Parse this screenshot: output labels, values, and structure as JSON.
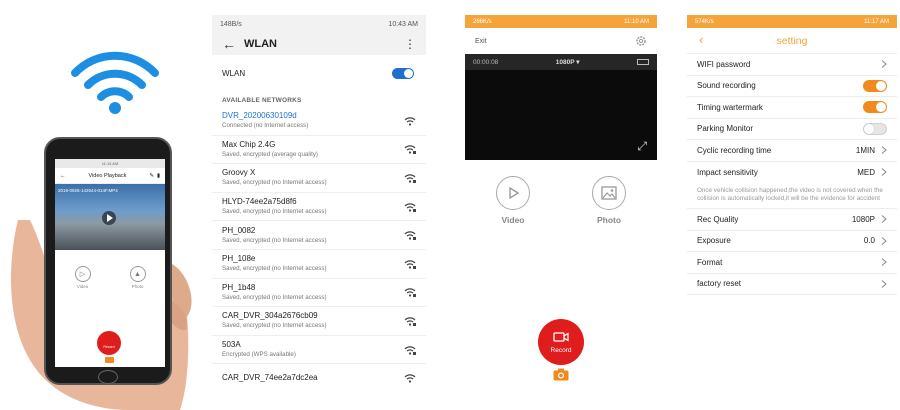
{
  "hero": {
    "phone_status_time": "11:14 AM",
    "phone_title": "Video Playback",
    "phone_file_name": "2019-0926-142544-014F.MP4",
    "phone_video_label": "Video",
    "phone_photo_label": "Photo",
    "phone_record_label": "Record"
  },
  "wlan": {
    "status_left": "148B/s",
    "status_right": "10:43 AM",
    "title": "WLAN",
    "toggle_label": "WLAN",
    "section_label": "AVAILABLE NETWORKS",
    "networks": [
      {
        "name": "DVR_20200630109d",
        "status": "Connected (no Internet access)"
      },
      {
        "name": "Max Chip 2.4G",
        "status": "Saved, encrypted (average quality)"
      },
      {
        "name": "Groovy X",
        "status": "Saved, encrypted (no Internet access)"
      },
      {
        "name": "HLYD-74ee2a75d8f6",
        "status": "Saved, encrypted (no Internet access)"
      },
      {
        "name": "PH_0082",
        "status": "Saved, encrypted (no Internet access)"
      },
      {
        "name": "PH_108e",
        "status": "Saved, encrypted (no Internet access)"
      },
      {
        "name": "PH_1b48",
        "status": "Saved, encrypted (no Internet access)"
      },
      {
        "name": "CAR_DVR_304a2676cb09",
        "status": "Saved, encrypted (no Internet access)"
      },
      {
        "name": "503A",
        "status": "Encrypted (WPS available)"
      },
      {
        "name": "CAR_DVR_74ee2a7dc2ea",
        "status": ""
      }
    ]
  },
  "camera": {
    "status_left": "266K/s",
    "status_right": "11:10 AM",
    "exit_label": "Exit",
    "timer": "00:00:08",
    "resolution": "1080P",
    "video_label": "Video",
    "photo_label": "Photo",
    "record_label": "Record"
  },
  "settings": {
    "status_left": "574K/s",
    "status_right": "11:17 AM",
    "title": "setting",
    "wifi_password": "WIFI password",
    "sound_recording": "Sound recording",
    "timing_watermark": "Timing wartermark",
    "parking_monitor": "Parking Monitor",
    "cyclic_recording": "Cyclic recording time",
    "cyclic_value": "1MIN",
    "impact_sensitivity": "Impact sensitivity",
    "impact_value": "MED",
    "impact_note": "Once vehicle collision happened,the video is not covered when the collision is automatically locked,it will be the evidence for accident",
    "rec_quality": "Rec Quality",
    "rec_quality_value": "1080P",
    "exposure": "Exposure",
    "exposure_value": "0.0",
    "format": "Format",
    "factory_reset": "factory reset"
  },
  "colors": {
    "accent_orange": "#f5a33b",
    "record_red": "#e01d1d",
    "wlan_blue": "#1f6fd1"
  }
}
